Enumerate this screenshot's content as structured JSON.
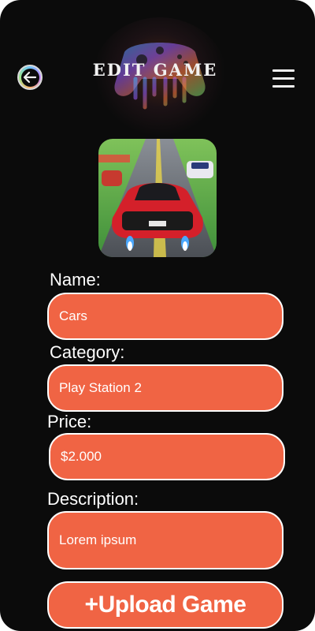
{
  "header": {
    "title": "EDIT GAME",
    "back_icon": "back-arrow-icon",
    "menu_icon": "hamburger-menu-icon",
    "logo_icon": "game-controller-icon"
  },
  "game_image": {
    "description_icon": "game-cover-image"
  },
  "form": {
    "name_label": "Name:",
    "name_value": "Cars",
    "category_label": "Category:",
    "category_value": "Play Station 2",
    "price_label": "Price:",
    "price_value": "$2.000",
    "description_label": "Description:",
    "description_value": "Lorem ipsum"
  },
  "actions": {
    "upload_label": "+Upload Game"
  },
  "colors": {
    "background": "#0b0b0b",
    "accent": "#f06444",
    "field_border": "#ffffff"
  }
}
